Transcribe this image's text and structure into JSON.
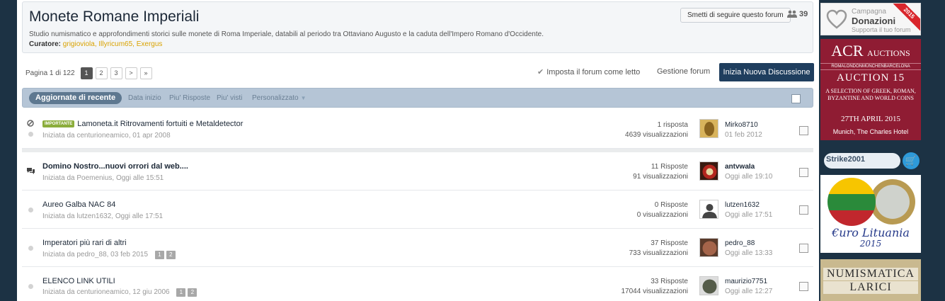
{
  "header": {
    "title": "Monete Romane Imperiali",
    "description": "Studio numismatico e approfondimenti storici sulle monete di Roma Imperiale, databili al periodo tra Ottaviano Augusto e la caduta dell'Impero Romano d'Occidente.",
    "curators_label": "Curatore:",
    "curators": "grigioviola, Illyricum65, Exergus",
    "follow_button": "Smetti di seguire questo forum",
    "followers_count": "39"
  },
  "pagination": {
    "info": "Pagina 1 di 122",
    "pages": [
      "1",
      "2",
      "3",
      ">",
      "»"
    ]
  },
  "actions": {
    "mark_read": "Imposta il forum come letto",
    "manage": "Gestione forum",
    "new_topic": "Inizia Nuova Discussione"
  },
  "filters": {
    "active": "Aggiornate di recente",
    "items": [
      "Data inizio",
      "Piu' Risposte",
      "Piu' visti",
      "Personalizzato"
    ]
  },
  "topics": [
    {
      "badge": "IMPORTANTE",
      "title": "Lamoneta.it Ritrovamenti fortuiti e Metaldetector",
      "meta": "Iniziata da centurioneamico, 01 apr 2008",
      "replies": "1 risposta",
      "views": "4639 visualizzazioni",
      "last_user": "Mirko8710",
      "last_date": "01 feb 2012"
    },
    {
      "title": "Domino Nostro...nuovi orrori dal web....",
      "meta": "Iniziata da Poemenius, Oggi alle 15:51",
      "replies": "11 Risposte",
      "views": "91 visualizzazioni",
      "last_user": "antvwaIa",
      "last_date": "Oggi alle 19:10"
    },
    {
      "title": "Aureo Galba NAC 84",
      "meta": "Iniziata da lutzen1632, Oggi alle 17:51",
      "replies": "0 Risposte",
      "views": "0 visualizzazioni",
      "last_user": "lutzen1632",
      "last_date": "Oggi alle 17:51"
    },
    {
      "title": "Imperatori più rari di altri",
      "meta": "Iniziata da pedro_88, 03 feb 2015",
      "mini_pages": [
        "1",
        "2"
      ],
      "replies": "37 Risposte",
      "views": "733 visualizzazioni",
      "last_user": "pedro_88",
      "last_date": "Oggi alle 13:33"
    },
    {
      "title": "ELENCO LINK UTILI",
      "meta": "Iniziata da centurioneamico, 12 giu 2006",
      "mini_pages": [
        "1",
        "2"
      ],
      "replies": "33 Risposte",
      "views": "17044 visualizzazioni",
      "last_user": "maurizio7751",
      "last_date": "Oggi alle 12:27"
    }
  ],
  "sidebar": {
    "donate": {
      "line1": "Campagna",
      "line2": "Donazioni",
      "line3": "Supporta il tuo forum",
      "ribbon": "2015"
    },
    "acr": {
      "logo": "ACR",
      "logo_small": "AUCTIONS",
      "cities": "ROMALONDONMÜNCHENBARCELONA",
      "auction": "AUCTION 15",
      "desc": "A SELECTION OF GREEK, ROMAN, BYZANTINE AND WORLD COINS",
      "date": "27TH APRIL 2015",
      "place": "Munich, The Charles Hotel"
    },
    "strike": "Strike2001",
    "euro": {
      "title": "€uro Lituania",
      "year": "2015"
    },
    "larici": {
      "line1": "NUMISMATICA",
      "line2": "LARICI"
    }
  },
  "colors": {
    "background": "#1c3244",
    "new_topic_button": "#1f3e5e",
    "filter_bar": "#b5c5d6",
    "badge": "#8bad3b",
    "curator_names": "#d9a200",
    "acr_ad": "#8f1c33"
  }
}
